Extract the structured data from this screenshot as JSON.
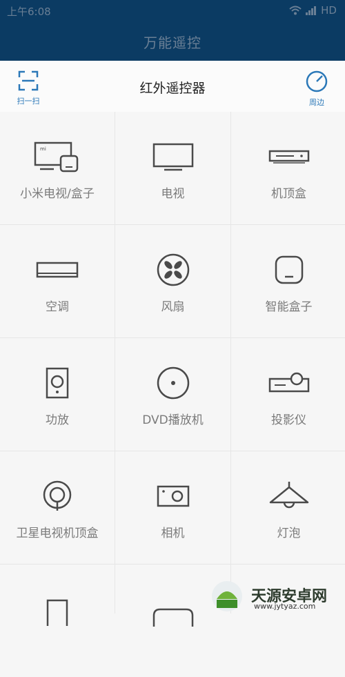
{
  "status_bar": {
    "time": "上午6:08",
    "network": "HD"
  },
  "header": {
    "app_title": "万能遥控"
  },
  "toolbar": {
    "title": "红外遥控器",
    "scan_label": "扫一扫",
    "nearby_label": "周边"
  },
  "devices": [
    {
      "label": "小米电视/盒子",
      "icon": "mi-tv-box-icon"
    },
    {
      "label": "电视",
      "icon": "tv-icon"
    },
    {
      "label": "机顶盒",
      "icon": "set-top-box-icon"
    },
    {
      "label": "空调",
      "icon": "air-conditioner-icon"
    },
    {
      "label": "风扇",
      "icon": "fan-icon"
    },
    {
      "label": "智能盒子",
      "icon": "smart-box-icon"
    },
    {
      "label": "功放",
      "icon": "amplifier-icon"
    },
    {
      "label": "DVD播放机",
      "icon": "dvd-icon"
    },
    {
      "label": "投影仪",
      "icon": "projector-icon"
    },
    {
      "label": "卫星电视机顶盒",
      "icon": "satellite-icon"
    },
    {
      "label": "相机",
      "icon": "camera-icon"
    },
    {
      "label": "灯泡",
      "icon": "lamp-icon"
    }
  ],
  "watermark": {
    "text": "天源安卓网",
    "url": "www.jytyaz.com"
  },
  "colors": {
    "header_bg": "#0b3b63",
    "accent": "#2b78b8",
    "icon_stroke": "#4a4a4a"
  }
}
